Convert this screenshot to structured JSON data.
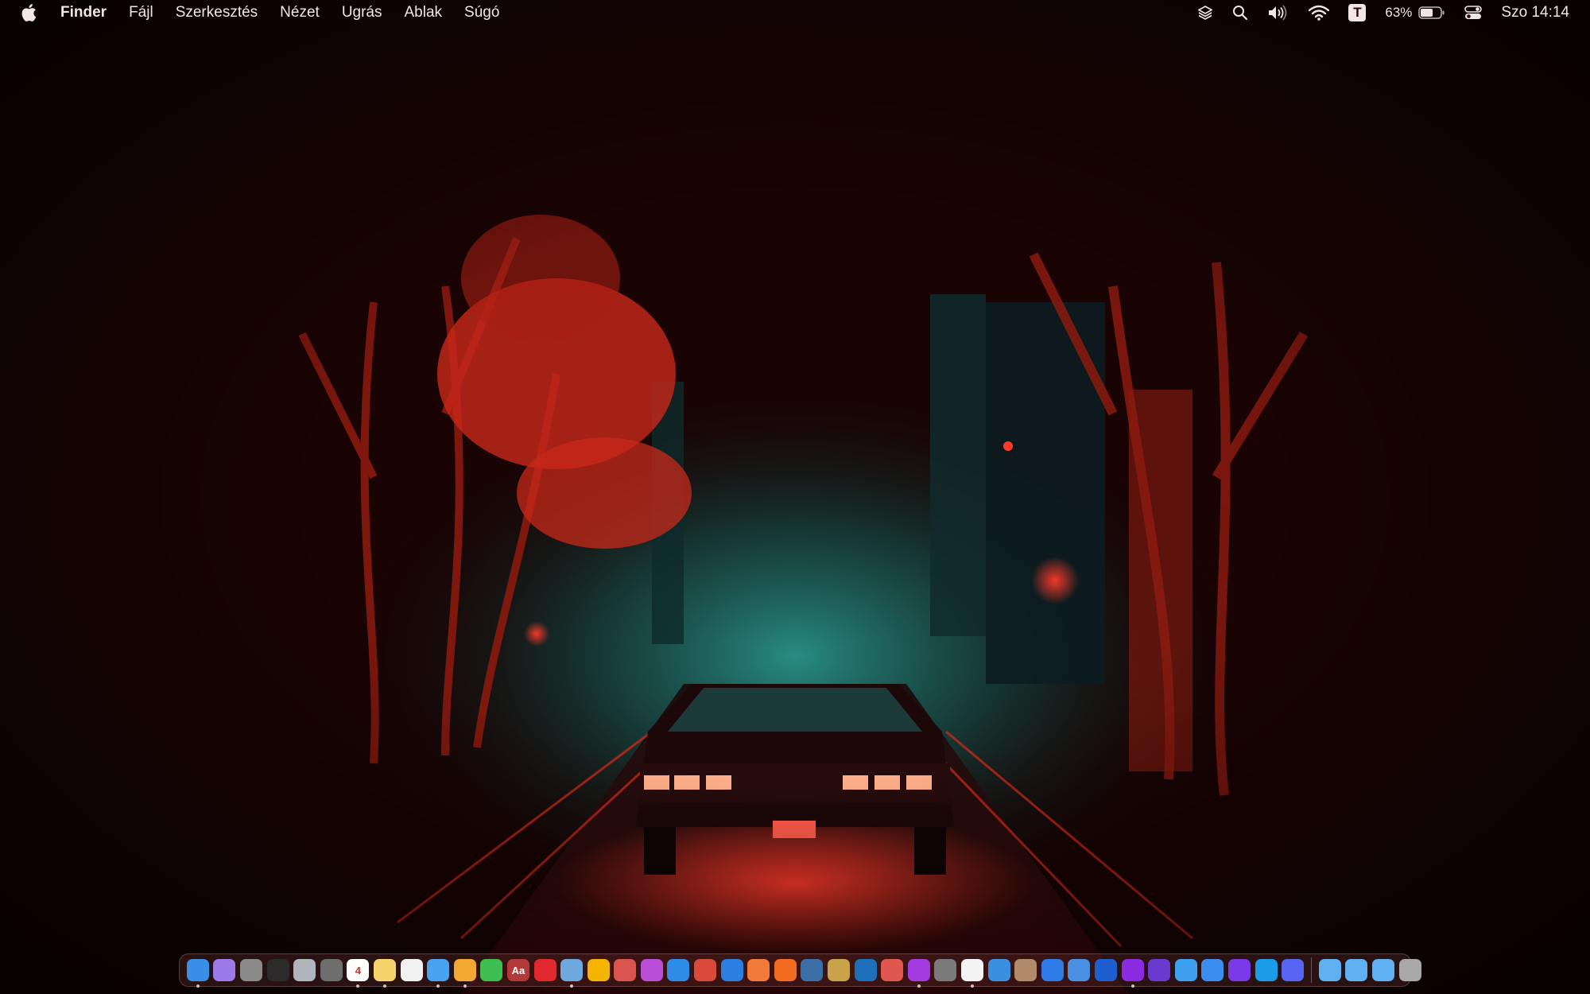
{
  "menubar": {
    "app_name": "Finder",
    "menus": [
      "Fájl",
      "Szerkesztés",
      "Nézet",
      "Ugrás",
      "Ablak",
      "Súgó"
    ],
    "status": {
      "stack_icon": "layers-icon",
      "search_icon": "search-icon",
      "volume_icon": "speaker-icon",
      "wifi_icon": "wifi-icon",
      "text_app_letter": "T",
      "battery_percent": "63%",
      "battery_level": 0.63,
      "control_center_icon": "toggle-icon",
      "clock": "Szo 14:14"
    }
  },
  "dock": {
    "apps": [
      {
        "name": "finder",
        "color": "#3a8ee6",
        "running": true
      },
      {
        "name": "notchmeister",
        "color": "#9b7be8",
        "running": false
      },
      {
        "name": "system-settings",
        "color": "#8a8a8a",
        "running": false
      },
      {
        "name": "activity-monitor",
        "color": "#2b2b2b",
        "running": false
      },
      {
        "name": "script-editor",
        "color": "#b0b4bb",
        "running": false
      },
      {
        "name": "gear-app",
        "color": "#6e6e6e",
        "running": false
      },
      {
        "name": "calendar",
        "color": "#ffffff",
        "running": true,
        "label": "4"
      },
      {
        "name": "notes",
        "color": "#f6d36b",
        "running": true
      },
      {
        "name": "textedit",
        "color": "#f0f0f0",
        "running": false
      },
      {
        "name": "freeform",
        "color": "#4aa3f0",
        "running": true
      },
      {
        "name": "pages",
        "color": "#f3a833",
        "running": true
      },
      {
        "name": "numbers",
        "color": "#3fbf4f",
        "running": false
      },
      {
        "name": "dictionary",
        "color": "#b33a3a",
        "running": false,
        "label": "Aa"
      },
      {
        "name": "acrobat",
        "color": "#e0282e",
        "running": false
      },
      {
        "name": "preview",
        "color": "#6fa8dc",
        "running": true
      },
      {
        "name": "photos",
        "color": "#f4b400",
        "running": false
      },
      {
        "name": "affinity-publisher",
        "color": "#d9534f",
        "running": false
      },
      {
        "name": "affinity-photo",
        "color": "#b84fd6",
        "running": false
      },
      {
        "name": "affinity-designer",
        "color": "#2d8ce6",
        "running": false
      },
      {
        "name": "compass-app",
        "color": "#d94a3a",
        "running": false
      },
      {
        "name": "tiles-app",
        "color": "#2a7fe0",
        "running": false
      },
      {
        "name": "disk-app",
        "color": "#f07a3a",
        "running": false
      },
      {
        "name": "keynote-app",
        "color": "#f26b1f",
        "running": false
      },
      {
        "name": "magnifier-app",
        "color": "#3c6fa8",
        "running": false
      },
      {
        "name": "brush-app",
        "color": "#c9a24a",
        "running": false
      },
      {
        "name": "audio-app",
        "color": "#1c6fb8",
        "running": false
      },
      {
        "name": "fx-app",
        "color": "#e0574f",
        "running": false
      },
      {
        "name": "podcasts",
        "color": "#a33be0",
        "running": true
      },
      {
        "name": "calculator",
        "color": "#7a7a7a",
        "running": false
      },
      {
        "name": "clock-app",
        "color": "#f4f4f4",
        "running": true
      },
      {
        "name": "cloud-app",
        "color": "#3b8fe0",
        "running": false
      },
      {
        "name": "photo-booth",
        "color": "#b08a6a",
        "running": false
      },
      {
        "name": "grid-app",
        "color": "#2f7be8",
        "running": false
      },
      {
        "name": "x-app",
        "color": "#4a90e2",
        "running": false
      },
      {
        "name": "m-app",
        "color": "#1e5fd0",
        "running": false
      },
      {
        "name": "shield-app",
        "color": "#8a2be2",
        "running": true
      },
      {
        "name": "plus-app",
        "color": "#6a3ad0",
        "running": false
      },
      {
        "name": "safari",
        "color": "#3fa0f0",
        "running": false
      },
      {
        "name": "mail",
        "color": "#3b8ef0",
        "running": false
      },
      {
        "name": "wave-app",
        "color": "#7a3ae8",
        "running": false
      },
      {
        "name": "skype",
        "color": "#1b9be8",
        "running": false
      },
      {
        "name": "discord",
        "color": "#5865f2",
        "running": false
      }
    ],
    "folders": [
      {
        "name": "applications-folder",
        "color": "#5fb0f0"
      },
      {
        "name": "documents-folder",
        "color": "#5fb0f0"
      },
      {
        "name": "downloads-folder",
        "color": "#5fb0f0"
      }
    ],
    "trash": {
      "name": "trash",
      "color": "#a8a8a8"
    }
  }
}
